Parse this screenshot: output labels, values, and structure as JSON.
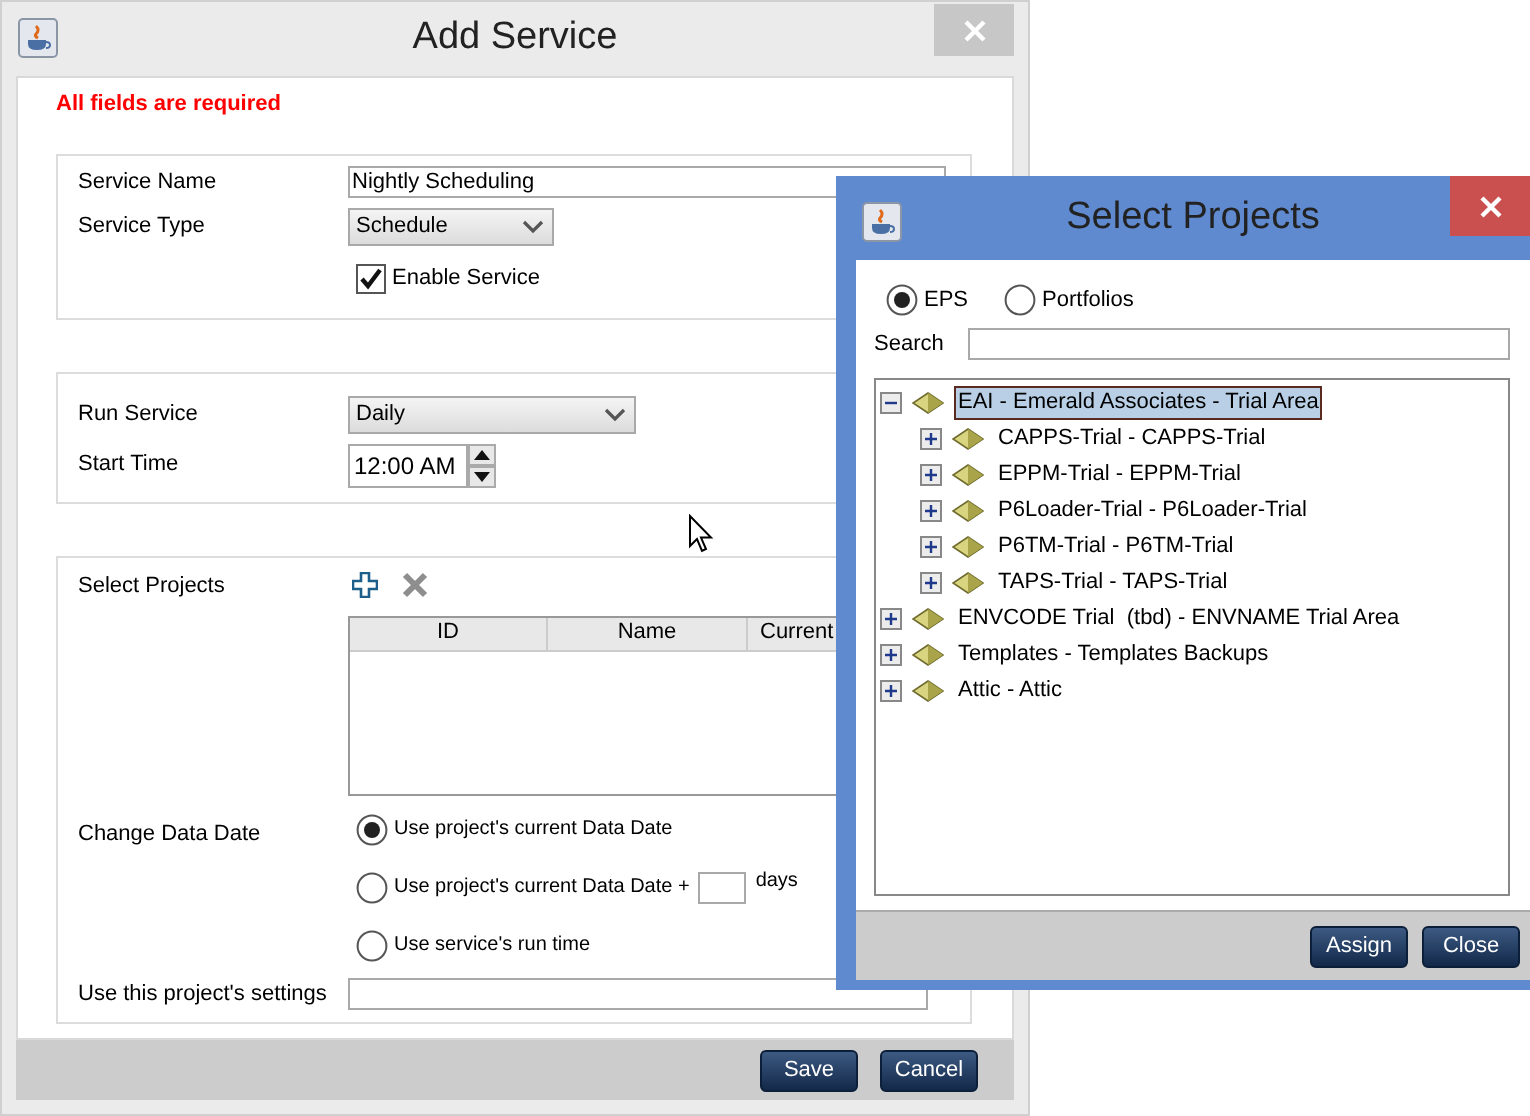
{
  "window": {
    "title": "Add Service"
  },
  "required_note": "All fields are required",
  "service": {
    "name_label": "Service Name",
    "name_value": "Nightly Scheduling",
    "type_label": "Service Type",
    "type_value": "Schedule",
    "enable_label": "Enable Service",
    "enable_checked": true
  },
  "schedule": {
    "run_label": "Run Service",
    "run_value": "Daily",
    "start_label": "Start Time",
    "start_value": "12:00 AM"
  },
  "projects": {
    "label": "Select Projects",
    "columns": [
      "ID",
      "Name",
      "Current"
    ]
  },
  "data_date": {
    "label": "Change Data Date",
    "options": [
      {
        "kind": "plain",
        "label": "Use project's current Data Date",
        "selected": true
      },
      {
        "kind": "days",
        "label": "Use project's current Data Date +",
        "suffix": "days",
        "selected": false
      },
      {
        "kind": "plain",
        "label": "Use service's run time",
        "selected": false
      }
    ]
  },
  "settings": {
    "label": "Use this project's settings"
  },
  "buttons": [
    "Save",
    "Cancel"
  ],
  "select_dialog": {
    "title": "Select Projects",
    "scopes": [
      {
        "label": "EPS",
        "selected": true
      },
      {
        "label": "Portfolios",
        "selected": false
      }
    ],
    "search_label": "Search",
    "tree": [
      {
        "label": "EAI - Emerald Associates - Trial Area",
        "expanded": true,
        "selected": true,
        "children": [
          {
            "label": "CAPPS-Trial - CAPPS-Trial",
            "expanded": false,
            "selected": false
          },
          {
            "label": "EPPM-Trial - EPPM-Trial",
            "expanded": false,
            "selected": false
          },
          {
            "label": "P6Loader-Trial - P6Loader-Trial",
            "expanded": false,
            "selected": false
          },
          {
            "label": "P6TM-Trial - P6TM-Trial",
            "expanded": false,
            "selected": false
          },
          {
            "label": "TAPS-Trial - TAPS-Trial",
            "expanded": false,
            "selected": false
          }
        ]
      },
      {
        "label": "ENVCODE Trial  (tbd) - ENVNAME Trial Area",
        "expanded": false,
        "selected": false
      },
      {
        "label": "Templates - Templates Backups",
        "expanded": false,
        "selected": false
      },
      {
        "label": "Attic - Attic",
        "expanded": false,
        "selected": false
      }
    ],
    "buttons": [
      "Assign",
      "Close"
    ]
  }
}
